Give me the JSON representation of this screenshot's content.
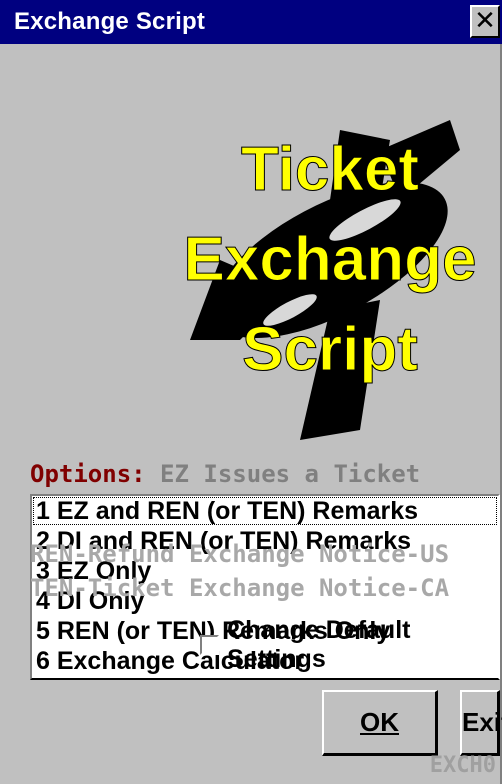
{
  "window": {
    "title": "Exchange Script",
    "close_label": "✕"
  },
  "logo": {
    "line1": "Ticket",
    "line2": "Exchange",
    "line3": "Script",
    "text_color": "#ffff00"
  },
  "options": {
    "label": "Options:",
    "hint": "EZ Issues a Ticket"
  },
  "list": {
    "items": [
      "1 EZ and REN (or TEN) Remarks",
      "2 DI and REN (or TEN) Remarks",
      "3 EZ Only",
      "4 DI Only",
      "5 REN (or TEN) Remarks Only",
      "6 Exchange Calculator"
    ]
  },
  "notes": {
    "ren": "REN-Refund Exchange Notice-US",
    "ten": "TEN-Ticket Exchange Notice-CA"
  },
  "checkbox": {
    "label": "Change Default Settings",
    "checked": false
  },
  "buttons": {
    "ok_label": "OK",
    "exit_label": "Exit"
  },
  "footer": {
    "code": "EXCH0"
  },
  "colors": {
    "titlebar": "#000080",
    "background": "#c0c0c0",
    "options_label": "#800000",
    "muted_text": "#a8a8a8"
  }
}
